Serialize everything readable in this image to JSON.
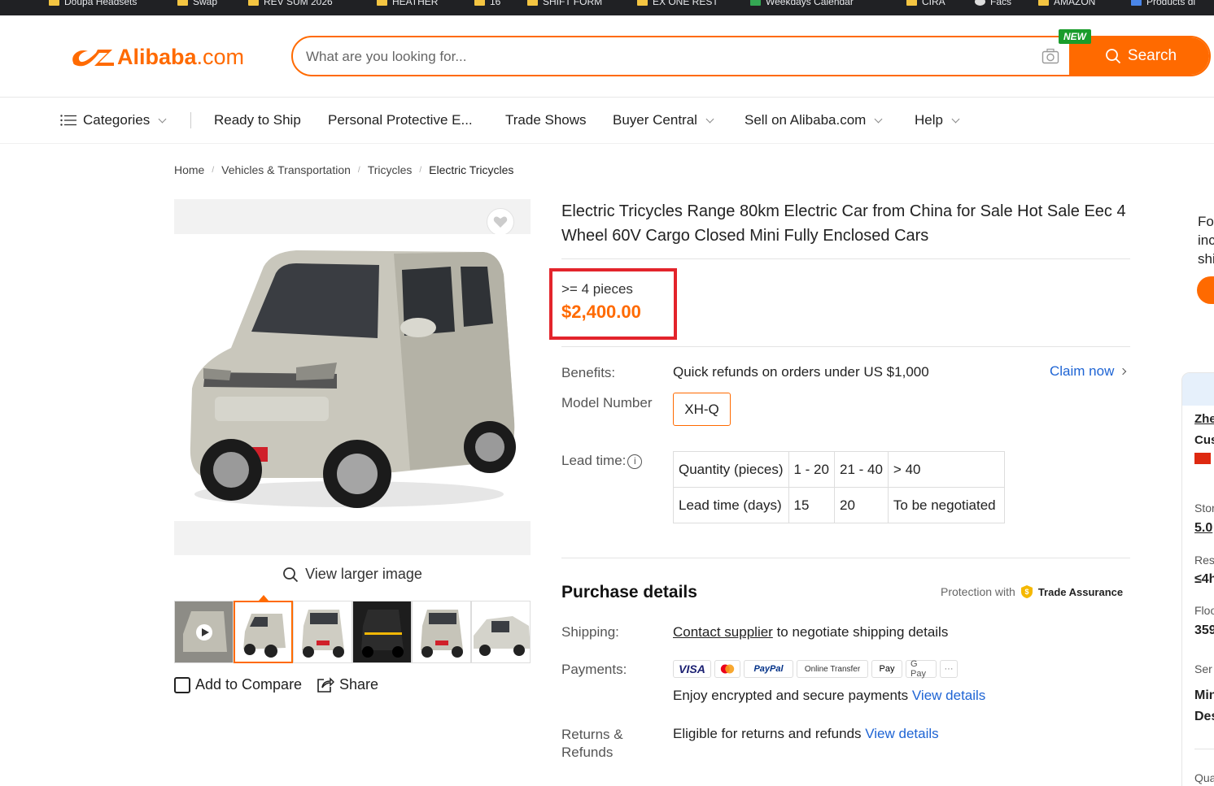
{
  "bookmarks": [
    "Doupa Headsets",
    "Swap",
    "REV SUM 2026",
    "HEATHER",
    "16",
    "SHIFT FORM",
    "EX ONE REST",
    "Weekdays Calendar",
    "CIRA",
    "Facs",
    "AMAZON",
    "Products di"
  ],
  "header": {
    "logo_word": "Alibaba",
    "logo_domain": ".com",
    "search_placeholder": "What are you looking for...",
    "search_button": "Search",
    "new_badge": "NEW"
  },
  "nav": {
    "categories": "Categories",
    "items": [
      "Ready to Ship",
      "Personal Protective E...",
      "Trade Shows",
      "Buyer Central",
      "Sell on Alibaba.com",
      "Help"
    ]
  },
  "breadcrumb": [
    "Home",
    "Vehicles & Transportation",
    "Tricycles",
    "Electric Tricycles"
  ],
  "gallery": {
    "view_larger": "View larger image",
    "add_to_compare": "Add to Compare",
    "share": "Share"
  },
  "product": {
    "title": "Electric Tricycles Range 80km Electric Car from China for Sale Hot Sale Eec 4 Wheel 60V Cargo Closed Mini Fully Enclosed Cars",
    "qty_label": ">= 4 pieces",
    "price": "$2,400.00",
    "benefits_label": "Benefits:",
    "benefits_value": "Quick refunds on orders under US $1,000",
    "claim_now": "Claim now",
    "model_label": "Model Number",
    "model_value": "XH-Q",
    "lead_label": "Lead time:",
    "lead_table": [
      [
        "Quantity (pieces)",
        "1 - 20",
        "21 - 40",
        "> 40"
      ],
      [
        "Lead time (days)",
        "15",
        "20",
        "To be negotiated"
      ]
    ]
  },
  "purchase": {
    "title": "Purchase details",
    "protection_prefix": "Protection with",
    "trade_assurance": "Trade Assurance",
    "shipping_label": "Shipping:",
    "shipping_link": "Contact supplier",
    "shipping_rest": " to negotiate shipping details",
    "payments_label": "Payments:",
    "payment_methods": [
      "VISA",
      "MC",
      "PayPal",
      "Online Transfer",
      "Pay",
      "G Pay",
      "···"
    ],
    "payments_text": "Enjoy encrypted and secure payments ",
    "view_details": "View details",
    "returns_label_1": "Returns &",
    "returns_label_2": "Refunds",
    "returns_text": "Eligible for returns and refunds "
  },
  "side": {
    "lines": [
      "Fo",
      "inc",
      "shi"
    ],
    "panel": [
      "Zhe",
      "Cus",
      "Stor",
      "5.0",
      "Res",
      "≤4h",
      "Floo",
      "359",
      "Ser",
      "Min",
      "Des",
      "Qua"
    ]
  },
  "colors": {
    "accent": "#ff6a00",
    "link": "#1e64d4",
    "highlight": "#e3242b"
  }
}
